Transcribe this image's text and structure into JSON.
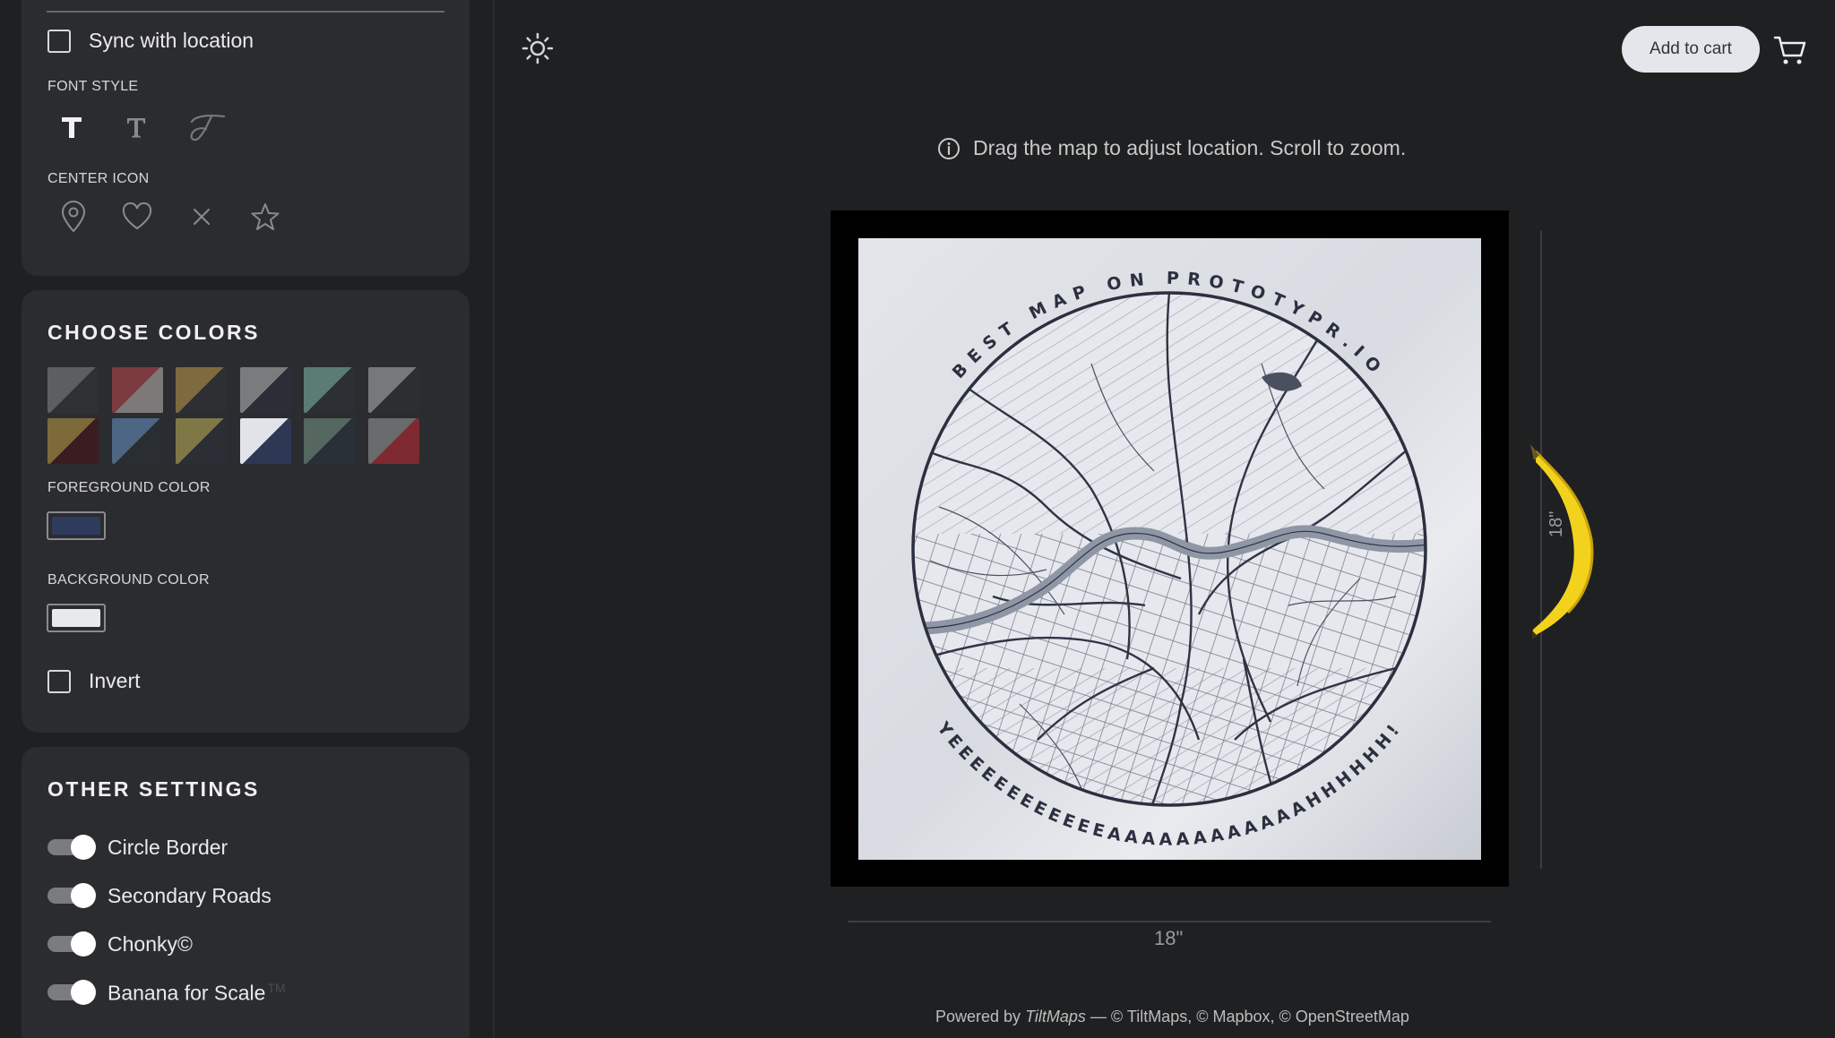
{
  "sidebar": {
    "sync": {
      "label": "Sync with location",
      "checked": false
    },
    "font_style": {
      "heading": "FONT STYLE",
      "options": [
        "sans-bold",
        "serif",
        "script"
      ],
      "selected": 0
    },
    "center_icon": {
      "heading": "CENTER ICON",
      "options": [
        "pin-icon",
        "heart-icon",
        "cross-icon",
        "star-icon"
      ]
    },
    "colors": {
      "heading": "CHOOSE COLORS",
      "swatches": [
        [
          "#5c5e61",
          "#2f3033"
        ],
        [
          "#7a3a3e",
          "#7c7a79"
        ],
        [
          "#7e6a3f",
          "#2d2f33"
        ],
        [
          "#7a7b7e",
          "#2b2e37"
        ],
        [
          "#5a7c72",
          "#2c2f33"
        ],
        [
          "#76797b",
          "#2d2e31"
        ],
        [
          "#7d6a3a",
          "#3b1c20"
        ],
        [
          "#4c6683",
          "#2a2d31"
        ],
        [
          "#7f7846",
          "#2b2e35"
        ],
        [
          "#e1e3e8",
          "#2e3754"
        ],
        [
          "#55675f",
          "#293038"
        ],
        [
          "#6a6b6d",
          "#7d2a31"
        ]
      ],
      "foreground": {
        "label": "FOREGROUND COLOR",
        "value": "#2f3b5c"
      },
      "background": {
        "label": "BACKGROUND COLOR",
        "value": "#e8e9ec"
      },
      "invert": {
        "label": "Invert",
        "checked": false
      }
    },
    "other": {
      "heading": "OTHER SETTINGS",
      "toggles": [
        {
          "label": "Circle Border",
          "on": true
        },
        {
          "label": "Secondary Roads",
          "on": true
        },
        {
          "label": "Chonky©",
          "on": true
        },
        {
          "label": "Banana for Scale",
          "on": true,
          "suffix": "TM"
        }
      ]
    }
  },
  "header": {
    "theme_icon": "sun-icon",
    "cart_button": "Add to cart",
    "cart_icon": "cart-icon"
  },
  "main": {
    "hint": "Drag the map to adjust location. Scroll to zoom.",
    "poster_text": {
      "top": "BEST MAP ON PROTOTYPR.IO",
      "bottom": "YEEEEEEEEEEEEAAAAAAAAAAAAHHHHHH!"
    },
    "width_label": "18\"",
    "height_label": "18\"",
    "footer": {
      "prefix": "Powered by ",
      "brand": "TiltMaps",
      "suffix": " — © TiltMaps, © Mapbox, © OpenStreetMap"
    }
  }
}
